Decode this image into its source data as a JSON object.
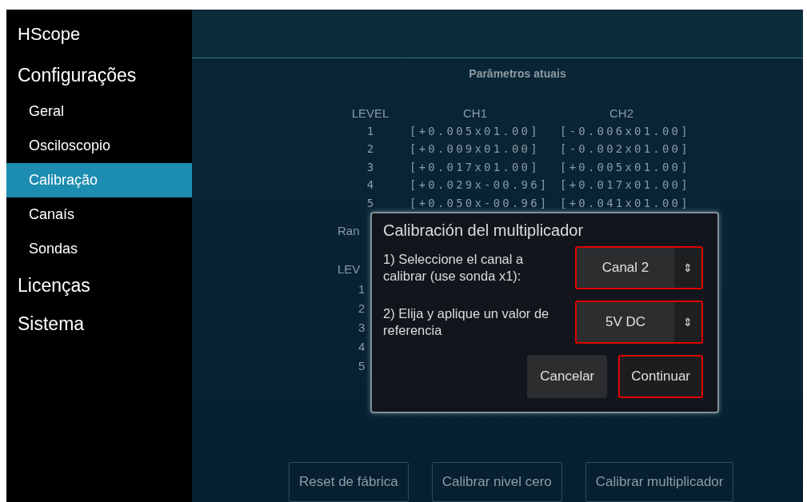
{
  "app_title": "HScope",
  "sidebar": {
    "items": [
      {
        "label": "Configurações",
        "selected": false,
        "children": [
          {
            "label": "Geral",
            "selected": false
          },
          {
            "label": "Osciloscopio",
            "selected": false
          },
          {
            "label": "Calibração",
            "selected": true
          },
          {
            "label": "Canaís",
            "selected": false
          },
          {
            "label": "Sondas",
            "selected": false
          }
        ]
      },
      {
        "label": "Licenças",
        "selected": false
      },
      {
        "label": "Sistema",
        "selected": false
      }
    ]
  },
  "current_parameters": {
    "title": "Parâmetros atuais",
    "columns": [
      "LEVEL",
      "CH1",
      "CH2"
    ],
    "rows": [
      {
        "cells": [
          "1",
          "[+0.005x01.00]",
          "[-0.006x01.00]"
        ]
      },
      {
        "cells": [
          "2",
          "[+0.009x01.00]",
          "[-0.002x01.00]"
        ]
      },
      {
        "cells": [
          "3",
          "[+0.017x01.00]",
          "[+0.005x01.00]"
        ]
      },
      {
        "cells": [
          "4",
          "[+0.029x-00.96]",
          "[+0.017x01.00]"
        ]
      },
      {
        "cells": [
          "5",
          "[+0.050x-00.96]",
          "[+0.041x01.00]"
        ]
      }
    ]
  },
  "second_table": {
    "title_fragment": "Ran",
    "column_fragment": "LEV",
    "row_labels": [
      "1",
      "2",
      "3",
      "4",
      "5"
    ]
  },
  "dialog": {
    "title": "Calibración del multiplicador",
    "fields": [
      {
        "label": "1) Seleccione el canal a calibrar (use sonda x1):",
        "value": "Canal 2",
        "arrow": "⇕",
        "highlighted": true
      },
      {
        "label": "2) Elija y aplique un valor de referencia",
        "value": "5V DC",
        "arrow": "⇕",
        "highlighted": true
      }
    ],
    "buttons": [
      {
        "label": "Cancelar",
        "highlighted": false
      },
      {
        "label": "Continuar",
        "highlighted": true
      }
    ]
  },
  "bottom_buttons": [
    "Reset de fábrica",
    "Calibrar nivel cero",
    "Calibrar multiplicador"
  ]
}
